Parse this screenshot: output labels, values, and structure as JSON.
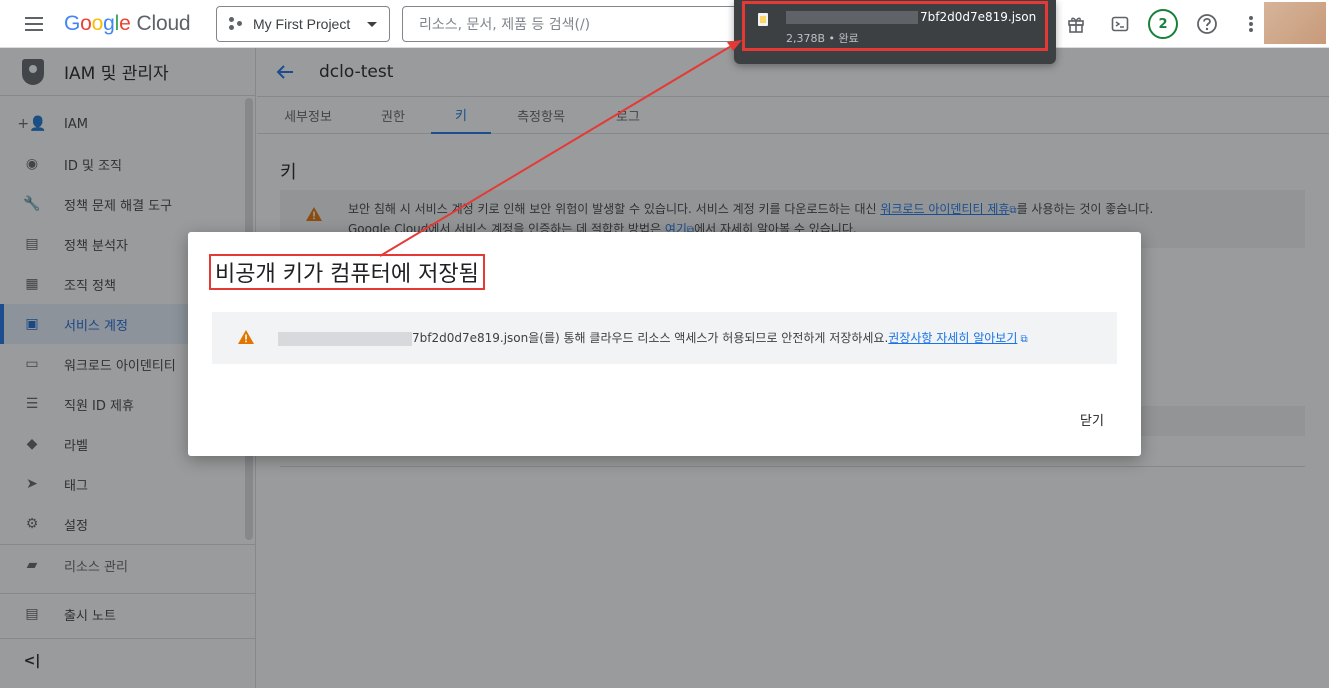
{
  "topbar": {
    "logo_google": [
      "G",
      "o",
      "o",
      "g",
      "l",
      "e"
    ],
    "logo_cloud": "Cloud",
    "project": "My First Project",
    "search_placeholder": "리소스, 문서, 제품 등 검색(/)",
    "notification_count": "2"
  },
  "download": {
    "filename_suffix": "7bf2d0d7e819.json",
    "meta": "2,378B • 완료"
  },
  "sidebar": {
    "title": "IAM 및 관리자",
    "items": [
      {
        "label": "IAM",
        "icon": "person-add-icon",
        "glyph": "+👤"
      },
      {
        "label": "ID 및 조직",
        "icon": "account-circle-icon",
        "glyph": "◉"
      },
      {
        "label": "정책 문제 해결 도구",
        "icon": "wrench-icon",
        "glyph": "🔧"
      },
      {
        "label": "정책 분석자",
        "icon": "document-search-icon",
        "glyph": "▤"
      },
      {
        "label": "조직 정책",
        "icon": "list-doc-icon",
        "glyph": "▦"
      },
      {
        "label": "서비스 계정",
        "icon": "service-account-icon",
        "glyph": "▣",
        "active": true
      },
      {
        "label": "워크로드 아이덴티티",
        "icon": "id-card-icon",
        "glyph": "▭"
      },
      {
        "label": "직원 ID 제휴",
        "icon": "list-icon",
        "glyph": "☰"
      },
      {
        "label": "라벨",
        "icon": "label-icon",
        "glyph": "◆"
      },
      {
        "label": "태그",
        "icon": "tag-icon",
        "glyph": "➤"
      },
      {
        "label": "설정",
        "icon": "gear-icon",
        "glyph": "⚙"
      }
    ],
    "resource_manage": "리소스 관리",
    "release_notes": "출시 노트",
    "collapse": "<|"
  },
  "main": {
    "title": "dclo-test",
    "tabs": [
      "세부정보",
      "권한",
      "키",
      "측정항목",
      "로그"
    ],
    "active_tab": "키",
    "section_title": "키",
    "alert_line1_a": "보안 침해 시 서비스 계정 키로 인해 보안 위험이 발생할 수 있습니다. 서비스 계정 키를 다운로드하는 대신 ",
    "alert_link1": "워크로드 아이덴티티 제휴",
    "alert_line1_b": "를 사용하는 것이 좋습니다.",
    "alert_line2_a": "Google Cloud에서 서비스 계정을 인증하는 데 적합한 방법은 ",
    "alert_link2": "여기",
    "alert_line2_b": "에서 자세히 알아볼 수 있습니다."
  },
  "dialog": {
    "title": "비공개 키가 컴퓨터에 저장됨",
    "message_filename": "7bf2d0d7e819.json",
    "message": "을(를) 통해 클라우드 리소스 액세스가 허용되므로 안전하게 저장하세요.",
    "link": "권장사항 자세히 알아보기",
    "close": "닫기"
  },
  "colors": {
    "accent": "#1a73e8",
    "warning": "#e37400",
    "annotation": "#e53935"
  }
}
